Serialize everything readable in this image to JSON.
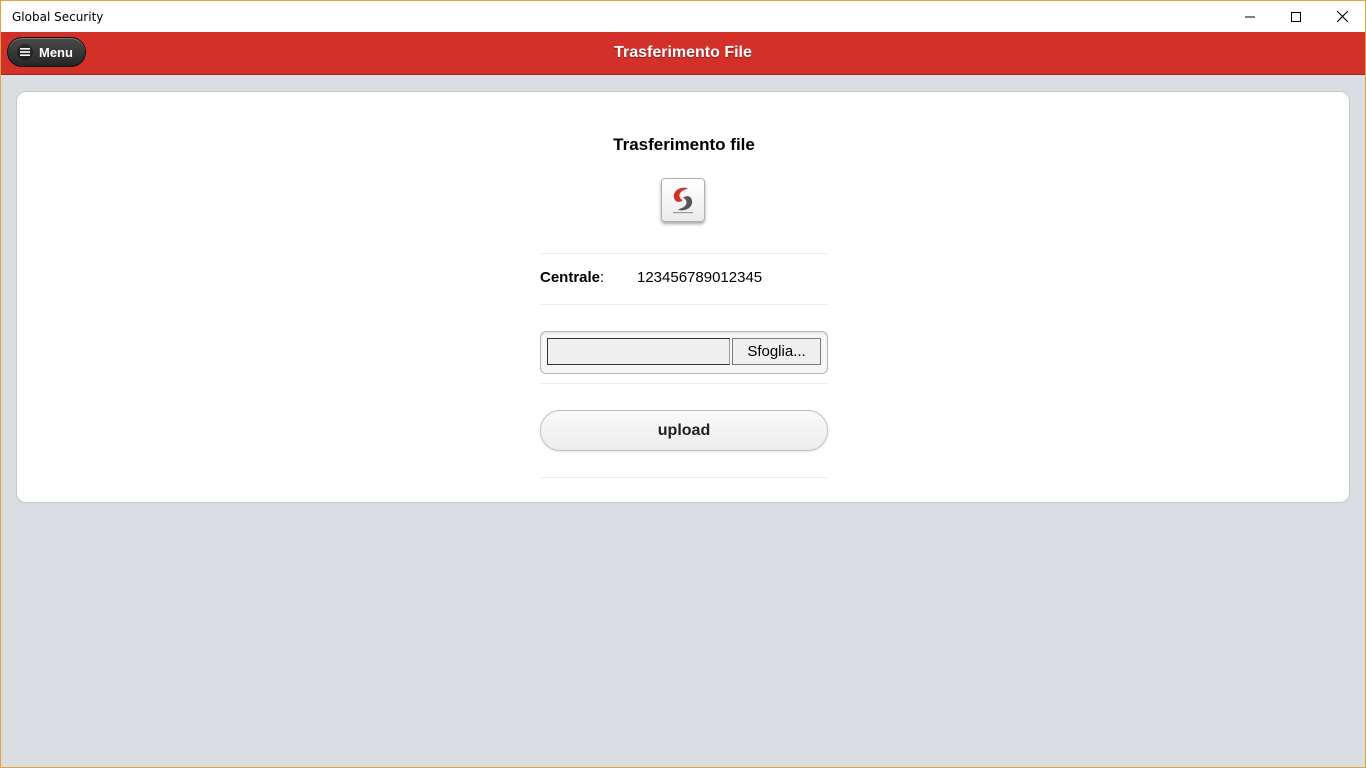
{
  "window": {
    "title": "Global Security",
    "controls": [
      "minimize-icon",
      "maximize-icon",
      "close-icon"
    ]
  },
  "header": {
    "menu_label": "Menu",
    "menu_icon": "hamburger-icon",
    "title": "Trasferimento File",
    "accent_color": "#d3302a"
  },
  "main": {
    "page_title": "Trasferimento file",
    "logo_icon": "global-security-logo",
    "centrale_label": "Centrale",
    "centrale_separator": ":",
    "centrale_value": "123456789012345",
    "file_input_value": "",
    "browse_label": "Sfoglia...",
    "upload_label": "upload"
  }
}
